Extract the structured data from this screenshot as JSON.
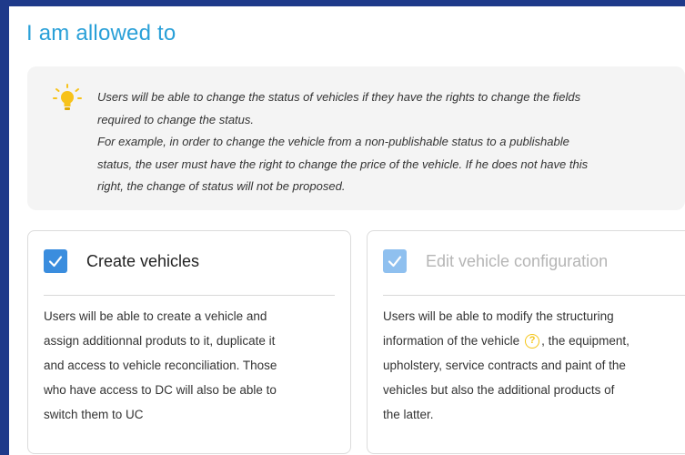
{
  "title": "I am allowed to",
  "info": {
    "lines": [
      "Users will be able to change the status of vehicles if they have the rights to change the fields",
      "required to change the status.",
      "For example, in order to change the vehicle from a non-publishable status to a publishable",
      "status, the user must have the right to change the price of the vehicle. If he does not have this",
      "right, the change of status will not be proposed."
    ]
  },
  "cards": [
    {
      "title": "Create vehicles",
      "checked": true,
      "lines": [
        "Users will be able to create a vehicle and",
        "assign additionnal produts to it, duplicate it",
        "and access to vehicle reconciliation. Those",
        "who have access to DC will also be able to",
        "switch them to UC"
      ]
    },
    {
      "title": "Edit vehicle configuration",
      "checked": true,
      "lines": [
        "Users will be able to modify the structuring",
        "information of the vehicle",
        ", the equipment,",
        "upholstery, service contracts and paint of the",
        "vehicles but also the additional products of",
        "the latter."
      ],
      "help_icon": "question-circle-icon"
    }
  ],
  "colors": {
    "accent": "#2aa0d8",
    "checkbox": "#3a8dde",
    "background": "#1e3a8a"
  }
}
